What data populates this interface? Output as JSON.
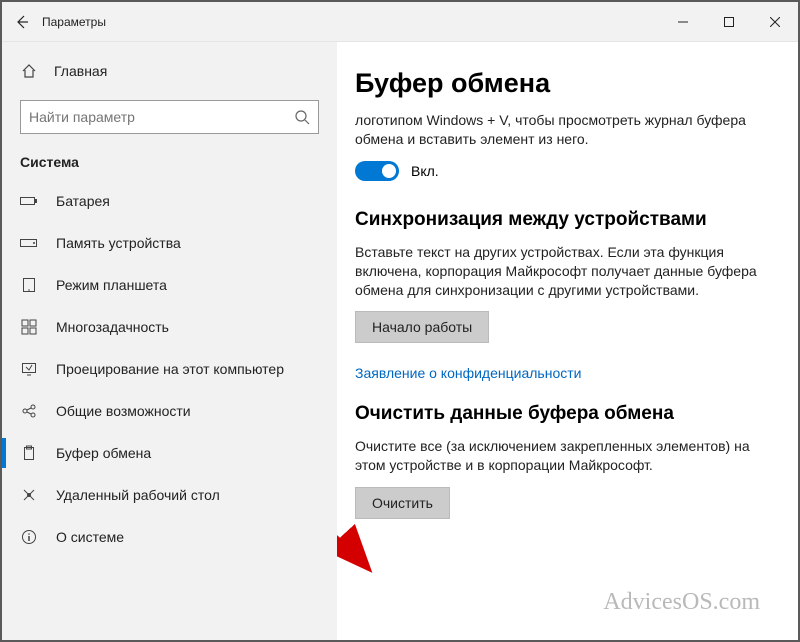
{
  "titlebar": {
    "title": "Параметры"
  },
  "sidebar": {
    "home_label": "Главная",
    "search_placeholder": "Найти параметр",
    "section": "Система",
    "items": [
      {
        "label": "Батарея"
      },
      {
        "label": "Память устройства"
      },
      {
        "label": "Режим планшета"
      },
      {
        "label": "Многозадачность"
      },
      {
        "label": "Проецирование на этот компьютер"
      },
      {
        "label": "Общие возможности"
      },
      {
        "label": "Буфер обмена"
      },
      {
        "label": "Удаленный рабочий стол"
      },
      {
        "label": "О системе"
      }
    ]
  },
  "main": {
    "heading": "Буфер обмена",
    "intro": "логотипом Windows + V, чтобы просмотреть журнал буфера обмена и вставить элемент из него.",
    "toggle_label": "Вкл.",
    "sync_heading": "Синхронизация между устройствами",
    "sync_text": "Вставьте текст на других устройствах. Если эта функция включена, корпорация Майкрософт получает данные буфера обмена для синхронизации с другими устройствами.",
    "get_started": "Начало работы",
    "privacy_link": "Заявление о конфиденциальности",
    "clear_heading": "Очистить данные буфера обмена",
    "clear_text": "Очистите все (за исключением закрепленных элементов) на этом устройстве и в корпорации Майкрософт.",
    "clear_button": "Очистить"
  },
  "watermark": "AdvicesOS.com"
}
